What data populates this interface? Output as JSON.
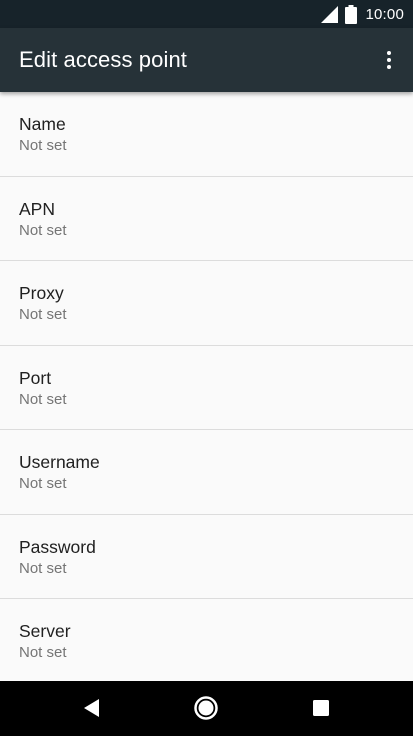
{
  "status_bar": {
    "time": "10:00",
    "icons": [
      "cell-signal-icon",
      "battery-icon"
    ]
  },
  "app_bar": {
    "title": "Edit access point",
    "menu_icon": "more-vert-icon"
  },
  "settings": [
    {
      "label": "Name",
      "value": "Not set"
    },
    {
      "label": "APN",
      "value": "Not set"
    },
    {
      "label": "Proxy",
      "value": "Not set"
    },
    {
      "label": "Port",
      "value": "Not set"
    },
    {
      "label": "Username",
      "value": "Not set"
    },
    {
      "label": "Password",
      "value": "Not set"
    },
    {
      "label": "Server",
      "value": "Not set"
    }
  ],
  "nav_bar": {
    "icons": [
      "back-icon",
      "home-icon",
      "recents-icon"
    ]
  },
  "colors": {
    "status_bar": "#17232a",
    "app_bar": "#263238",
    "background": "#fafafa",
    "primary_text": "#212121",
    "secondary_text": "#757575"
  }
}
